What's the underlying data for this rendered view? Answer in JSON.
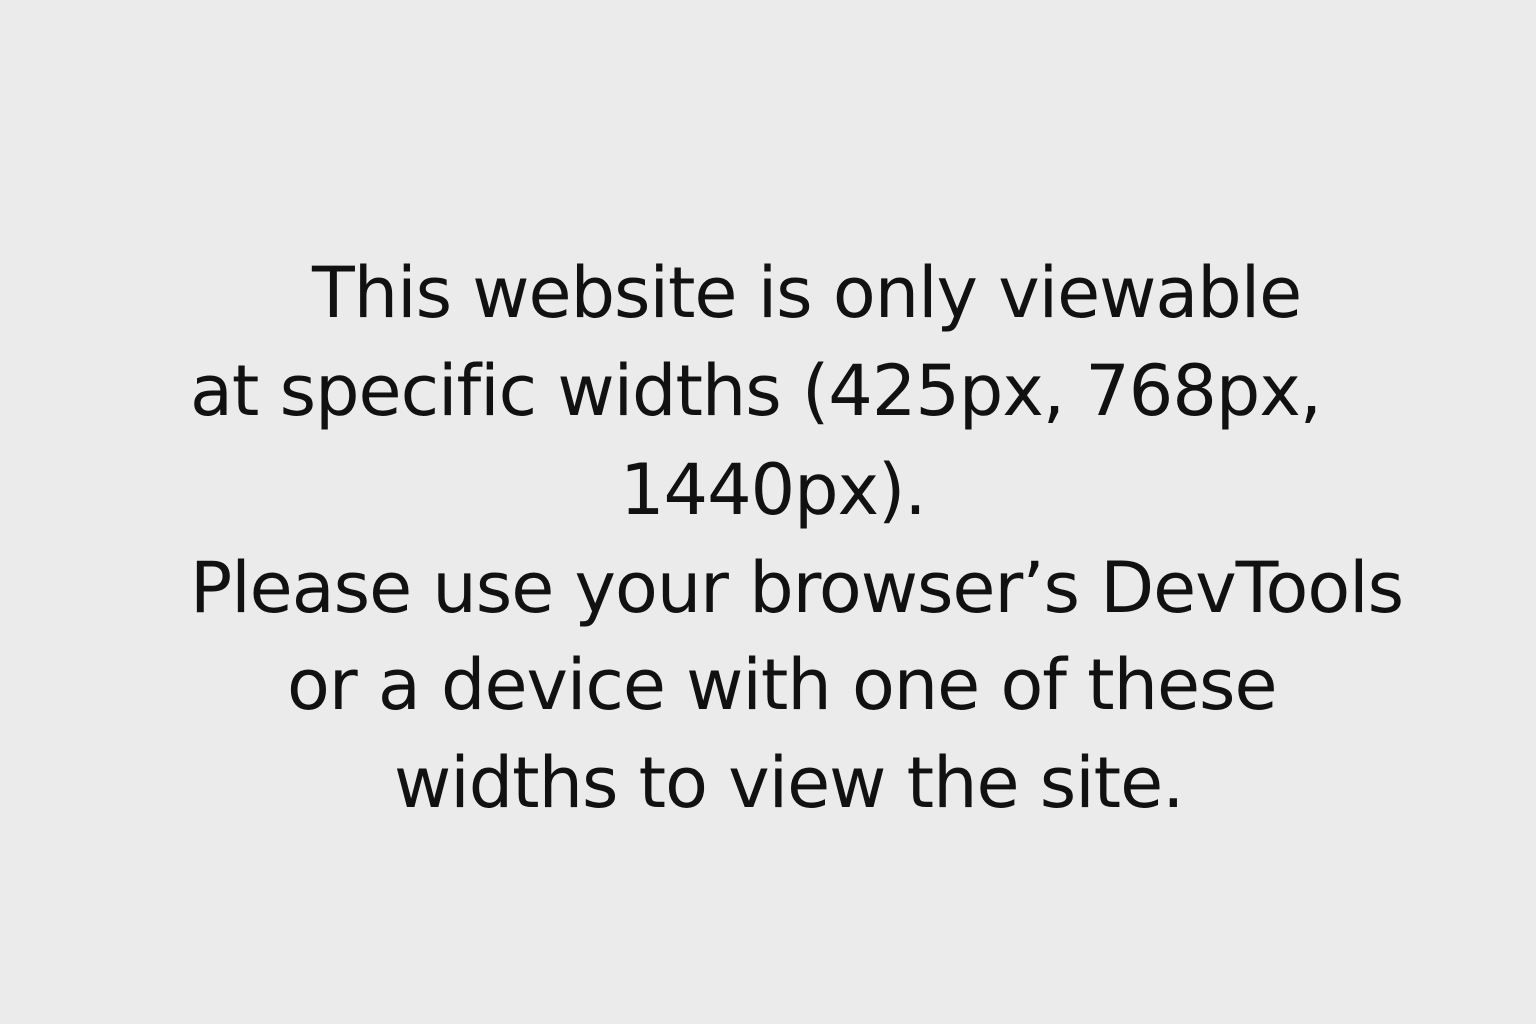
{
  "notice": {
    "lines": [
      "This website is only viewable",
      "at specific widths (425px, 768px,",
      "1440px).",
      "Please use your browser’s DevTools",
      "or a device with one of these",
      "widths to view the site."
    ]
  },
  "colors": {
    "background": "#ebebeb",
    "text": "#111111"
  }
}
